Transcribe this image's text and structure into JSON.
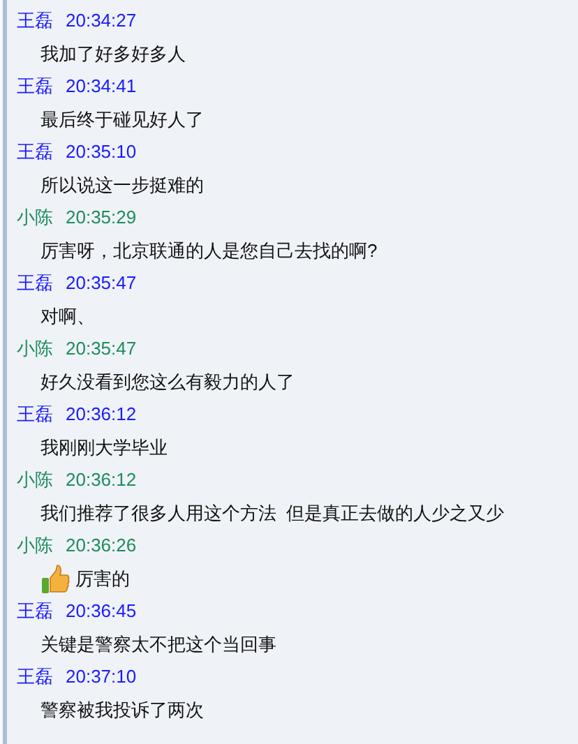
{
  "messages": [
    {
      "sender": "王磊",
      "time": "20:34:27",
      "color": "#1a1aff",
      "kind": "text",
      "text": "我加了好多好多人"
    },
    {
      "sender": "王磊",
      "time": "20:34:41",
      "color": "#1a1aff",
      "kind": "text",
      "text": "最后终于碰见好人了"
    },
    {
      "sender": "王磊",
      "time": "20:35:10",
      "color": "#1a1aff",
      "kind": "text",
      "text": "所以说这一步挺难的"
    },
    {
      "sender": "小陈",
      "time": "20:35:29",
      "color": "#1e8c5a",
      "kind": "text",
      "text": "厉害呀，北京联通的人是您自己去找的啊?"
    },
    {
      "sender": "王磊",
      "time": "20:35:47",
      "color": "#1a1aff",
      "kind": "text",
      "text": "对啊、"
    },
    {
      "sender": "小陈",
      "time": "20:35:47",
      "color": "#1e8c5a",
      "kind": "text",
      "text": "好久没看到您这么有毅力的人了"
    },
    {
      "sender": "王磊",
      "time": "20:36:12",
      "color": "#1a1aff",
      "kind": "text",
      "text": "我刚刚大学毕业"
    },
    {
      "sender": "小陈",
      "time": "20:36:12",
      "color": "#1e8c5a",
      "kind": "text",
      "text": "我们推荐了很多人用这个方法  但是真正去做的人少之又少"
    },
    {
      "sender": "小陈",
      "time": "20:36:26",
      "color": "#1e8c5a",
      "kind": "thumbs_up",
      "text": "厉害的"
    },
    {
      "sender": "王磊",
      "time": "20:36:45",
      "color": "#1a1aff",
      "kind": "text",
      "text": "关键是警察太不把这个当回事"
    },
    {
      "sender": "王磊",
      "time": "20:37:10",
      "color": "#1a1aff",
      "kind": "text",
      "text": "警察被我投诉了两次"
    }
  ]
}
